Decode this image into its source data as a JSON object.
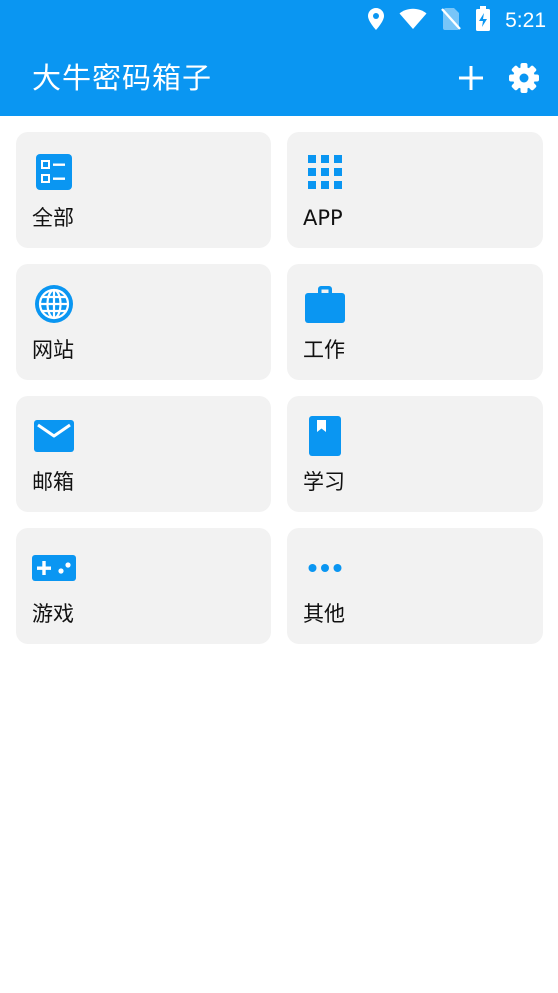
{
  "status_bar": {
    "time": "5:21",
    "icons": [
      "location-icon",
      "wifi-icon",
      "no-sim-icon",
      "battery-charging-icon"
    ]
  },
  "header": {
    "title": "大牛密码箱子",
    "actions": [
      {
        "icon": "add-icon"
      },
      {
        "icon": "gear-icon"
      }
    ]
  },
  "categories": [
    {
      "label": "全部",
      "icon": "dashboard-icon"
    },
    {
      "label": "APP",
      "icon": "apps-grid-icon"
    },
    {
      "label": "网站",
      "icon": "globe-icon"
    },
    {
      "label": "工作",
      "icon": "briefcase-icon"
    },
    {
      "label": "邮箱",
      "icon": "mail-icon"
    },
    {
      "label": "学习",
      "icon": "book-icon"
    },
    {
      "label": "游戏",
      "icon": "gamepad-icon"
    },
    {
      "label": "其他",
      "icon": "more-horiz-icon"
    }
  ],
  "colors": {
    "primary": "#0a96f2",
    "card_bg": "#f2f2f2",
    "text": "#111111",
    "on_primary": "#ffffff"
  }
}
